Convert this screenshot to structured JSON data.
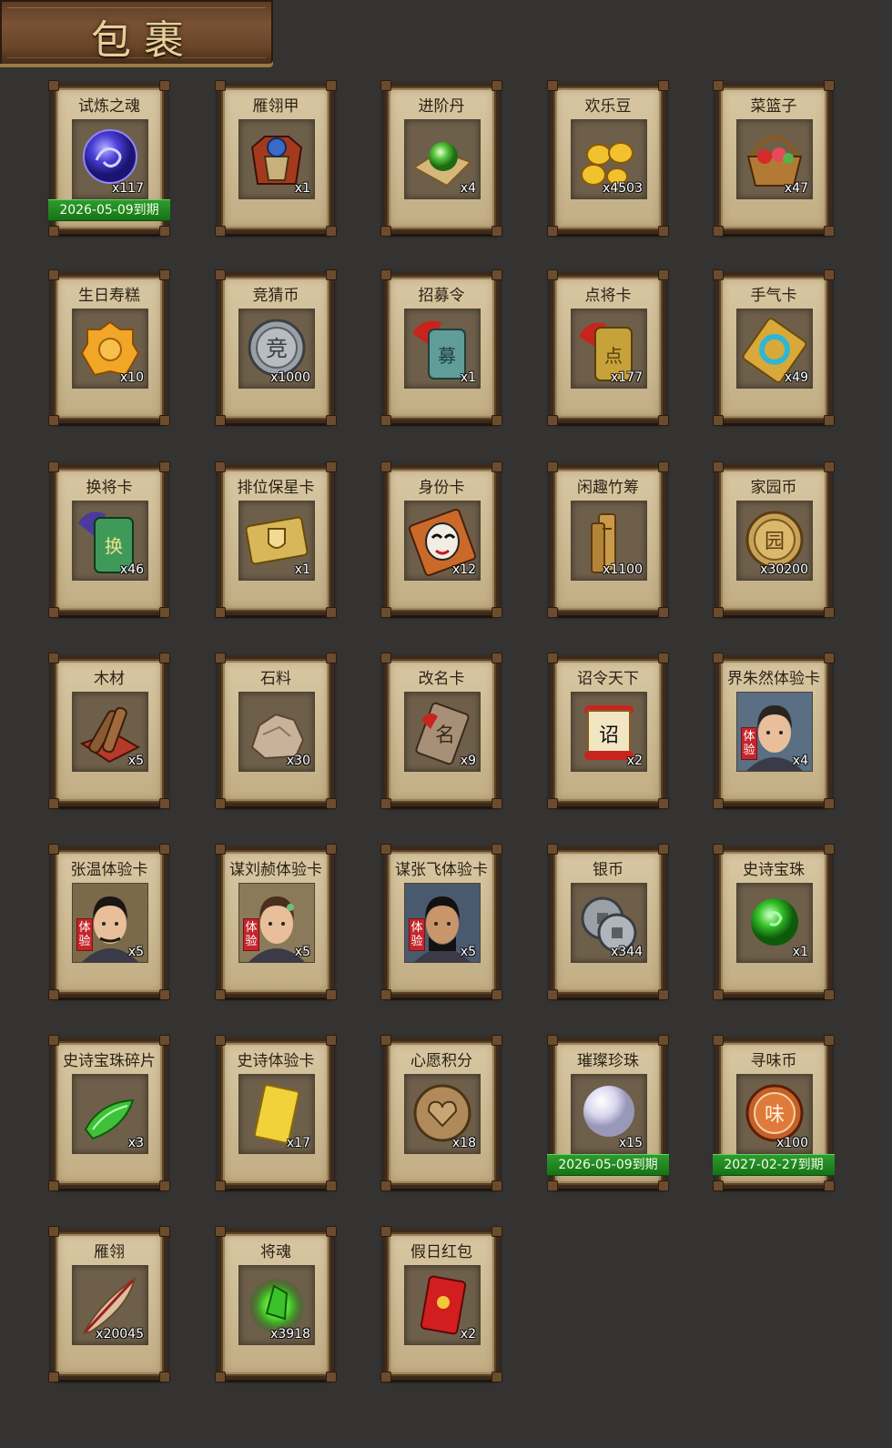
{
  "header": {
    "title": "包裹"
  },
  "items": [
    {
      "name": "试炼之魂",
      "qty": "x117",
      "icon": "dragon-orb-icon",
      "expiry": "2026-05-09到期"
    },
    {
      "name": "雁翎甲",
      "qty": "x1",
      "icon": "armor-icon"
    },
    {
      "name": "进阶丹",
      "qty": "x4",
      "icon": "green-pill-icon"
    },
    {
      "name": "欢乐豆",
      "qty": "x4503",
      "icon": "gold-beans-icon"
    },
    {
      "name": "菜篮子",
      "qty": "x47",
      "icon": "basket-icon"
    },
    {
      "name": "生日寿糕",
      "qty": "x10",
      "icon": "mooncake-icon"
    },
    {
      "name": "竞猜币",
      "qty": "x1000",
      "icon": "silver-coin-icon"
    },
    {
      "name": "招募令",
      "qty": "x1",
      "icon": "recruit-token-icon"
    },
    {
      "name": "点将卡",
      "qty": "x177",
      "icon": "general-token-icon"
    },
    {
      "name": "手气卡",
      "qty": "x49",
      "icon": "luck-card-icon"
    },
    {
      "name": "换将卡",
      "qty": "x46",
      "icon": "swap-token-icon"
    },
    {
      "name": "排位保星卡",
      "qty": "x1",
      "icon": "shield-card-icon"
    },
    {
      "name": "身份卡",
      "qty": "x12",
      "icon": "mask-card-icon"
    },
    {
      "name": "闲趣竹筹",
      "qty": "x1100",
      "icon": "bamboo-slip-icon"
    },
    {
      "name": "家园币",
      "qty": "x30200",
      "icon": "home-coin-icon"
    },
    {
      "name": "木材",
      "qty": "x5",
      "icon": "wood-icon"
    },
    {
      "name": "石料",
      "qty": "x30",
      "icon": "stone-icon"
    },
    {
      "name": "改名卡",
      "qty": "x9",
      "icon": "rename-card-icon"
    },
    {
      "name": "诏令天下",
      "qty": "x2",
      "icon": "scroll-icon"
    },
    {
      "name": "界朱然体验卡",
      "qty": "x4",
      "icon": "portrait-icon",
      "badge": "体验",
      "portrait": "male-young"
    },
    {
      "name": "张温体验卡",
      "qty": "x5",
      "icon": "portrait-icon",
      "badge": "体验",
      "portrait": "male-mustache"
    },
    {
      "name": "谋刘赪体验卡",
      "qty": "x5",
      "icon": "portrait-icon",
      "badge": "体验",
      "portrait": "female"
    },
    {
      "name": "谋张飞体验卡",
      "qty": "x5",
      "icon": "portrait-icon",
      "badge": "体验",
      "portrait": "male-fierce"
    },
    {
      "name": "银币",
      "qty": "x344",
      "icon": "silver-coins-icon"
    },
    {
      "name": "史诗宝珠",
      "qty": "x1",
      "icon": "green-orb-icon"
    },
    {
      "name": "史诗宝珠碎片",
      "qty": "x3",
      "icon": "jade-shard-icon"
    },
    {
      "name": "史诗体验卡",
      "qty": "x17",
      "icon": "gold-card-icon"
    },
    {
      "name": "心愿积分",
      "qty": "x18",
      "icon": "heart-coin-icon"
    },
    {
      "name": "璀璨珍珠",
      "qty": "x15",
      "icon": "pearl-icon",
      "expiry": "2026-05-09到期"
    },
    {
      "name": "寻味币",
      "qty": "x100",
      "icon": "flavor-coin-icon",
      "expiry": "2027-02-27到期"
    },
    {
      "name": "雁翎",
      "qty": "x20045",
      "icon": "feather-icon"
    },
    {
      "name": "将魂",
      "qty": "x3918",
      "icon": "soul-crystal-icon"
    },
    {
      "name": "假日红包",
      "qty": "x2",
      "icon": "red-envelope-icon"
    }
  ]
}
